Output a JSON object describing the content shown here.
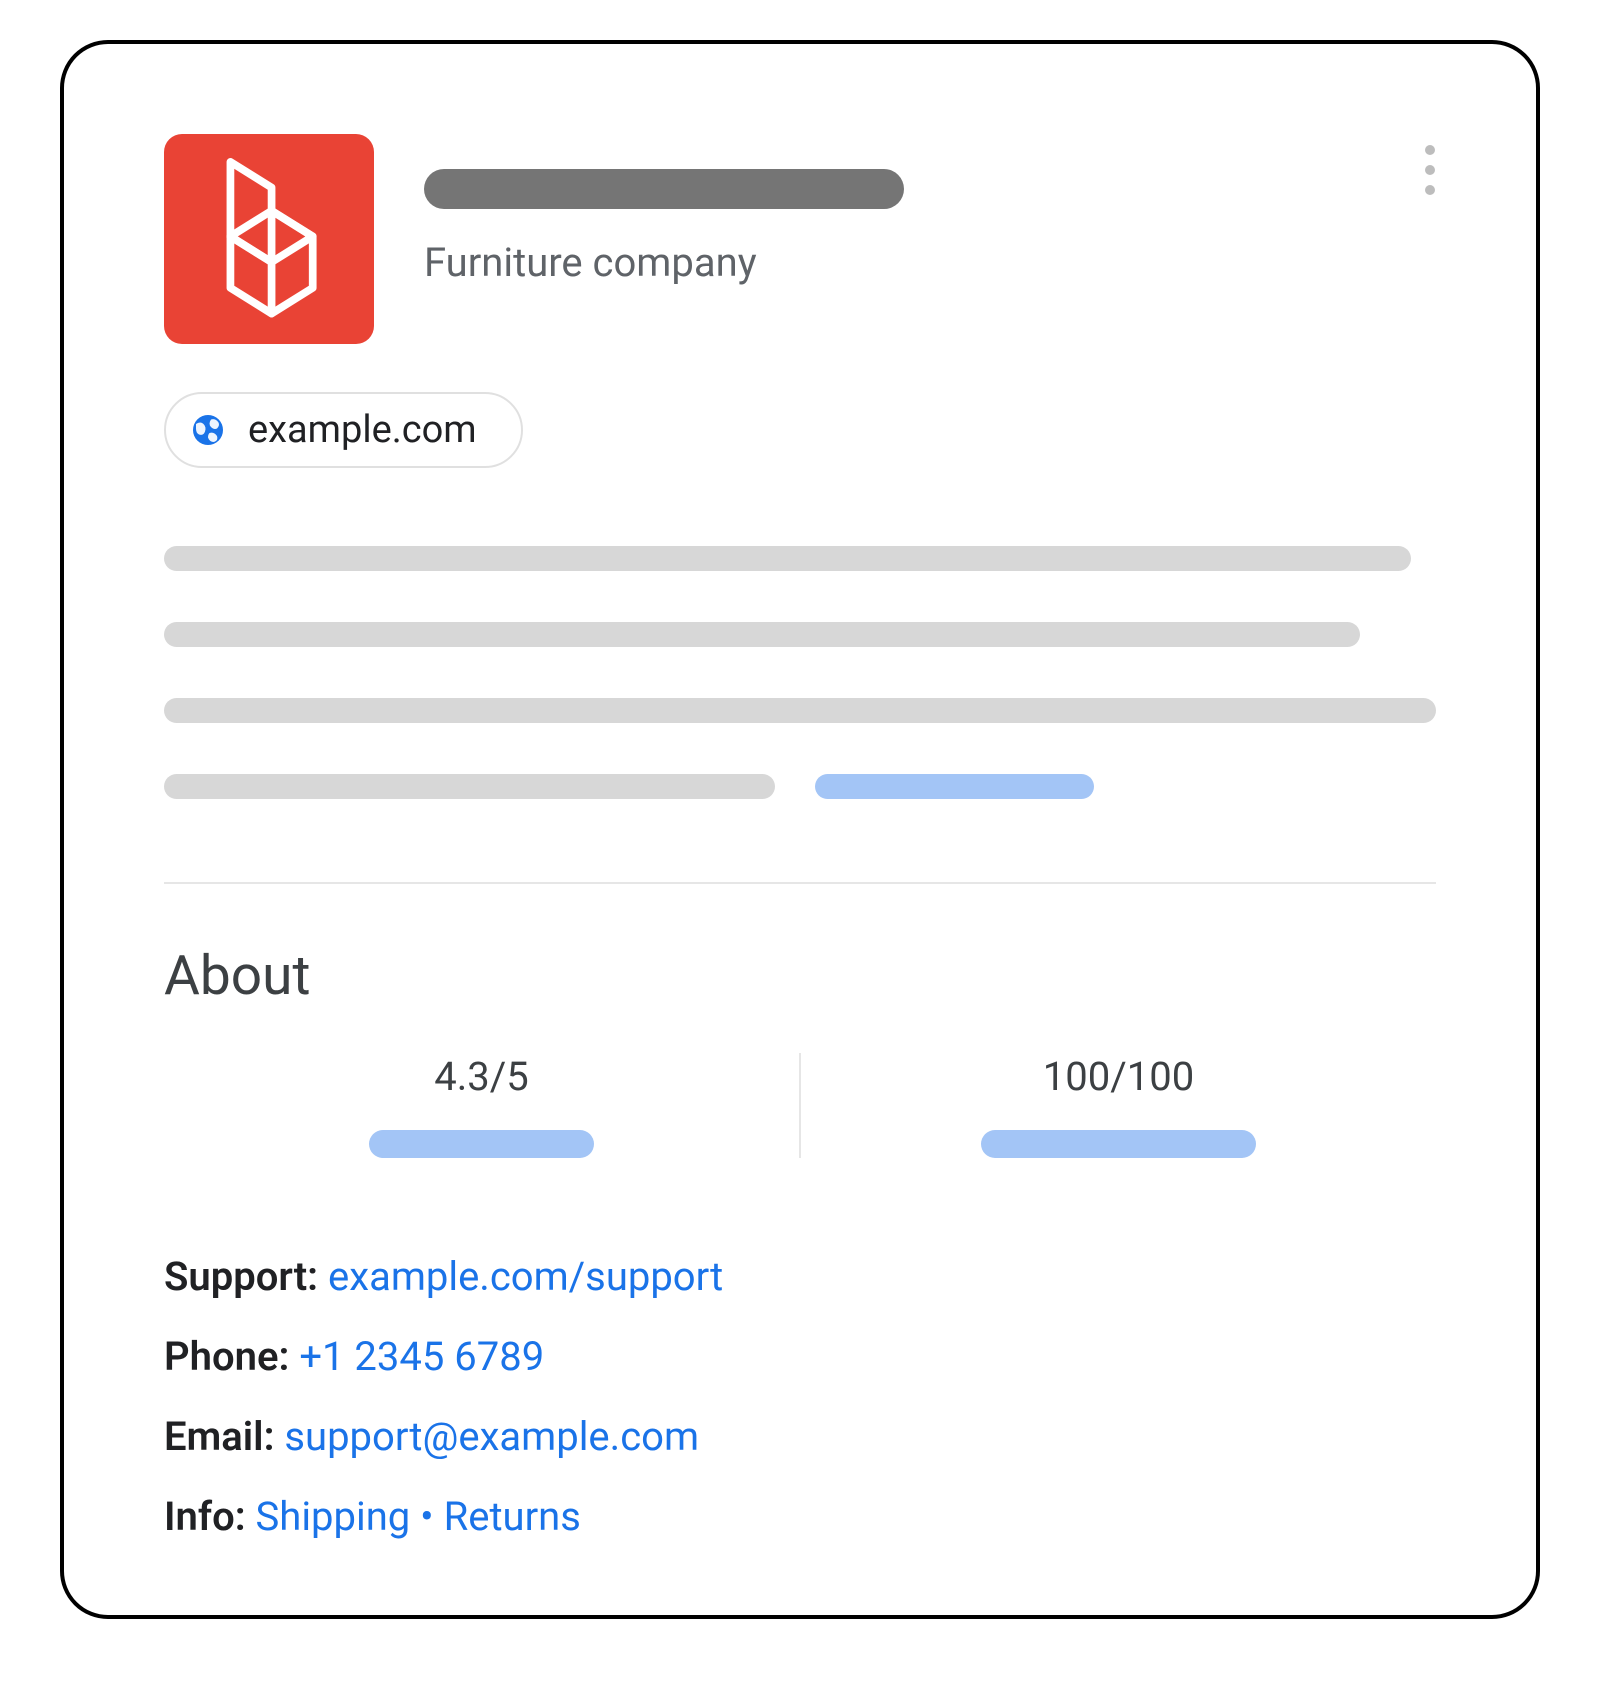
{
  "header": {
    "subtitle": "Furniture company"
  },
  "urlChip": {
    "text": "example.com"
  },
  "about": {
    "title": "About",
    "metrics": [
      {
        "value": "4.3/5"
      },
      {
        "value": "100/100"
      }
    ]
  },
  "info": {
    "support": {
      "label": "Support:",
      "link": "example.com/support"
    },
    "phone": {
      "label": "Phone:",
      "link": "+1 2345 6789"
    },
    "email": {
      "label": "Email:",
      "link": "support@example.com"
    },
    "more": {
      "label": "Info:",
      "shipping": "Shipping",
      "sep": " • ",
      "returns": "Returns"
    }
  }
}
